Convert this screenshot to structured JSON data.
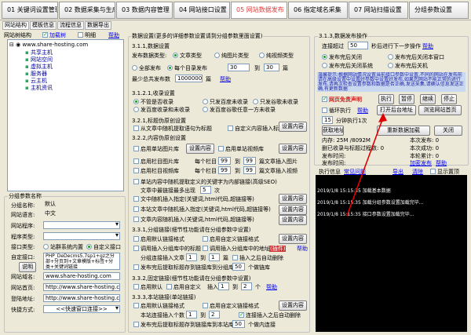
{
  "tabs": [
    "01 关键词设置管理",
    "02 数据采集与生成",
    "03 数据内容管理",
    "04 网站接口设置",
    "05 网站数据发布",
    "06 指定域名采集",
    "07 网站扫描设置",
    "分组参数设置"
  ],
  "subtabs": [
    "网站结构",
    "模板信息",
    "流程信息",
    "数据导出"
  ],
  "left": {
    "title": "网站树结构",
    "add_label": "加载树",
    "clear_label": "明细",
    "help": "帮助",
    "tree": [
      "www.share-hosting.com",
      "共享主机",
      "网站空间",
      "虚拟主机",
      "服务器",
      "云主机",
      "主机资讯"
    ],
    "params_title": "分组参数名称",
    "fields": [
      [
        "分组名称:",
        "默认"
      ],
      [
        "网站语言:",
        "中文"
      ],
      [
        "网站程序:",
        ""
      ],
      [
        "程序类型:",
        ""
      ],
      [
        "接口类型:",
        ""
      ],
      [
        "自定接口:",
        ""
      ]
    ],
    "interface_radio1": "站群系统内置",
    "interface_radio2": "自定义接口",
    "explain": "说明",
    "desc_text": "PHP_DeDecms5.7sp1+gz之分部+分页到+文章模版+标签+分类+关键词链接",
    "domain_label": "网站域名:",
    "domain": "www.share-hosting.com",
    "home_label": "网站首页:",
    "home": "http://www.share-hosting.com",
    "login_label": "登陆地址:",
    "login": "http://www.share-hosting.com",
    "fast_label": "快捷方式:",
    "fast": "<<快速窗口连接>>"
  },
  "mid": {
    "title": "数据设置(更多的详细参数设置请到分组参数里面设置)",
    "s1": "3.1.1,数据设置",
    "pubtype_label": "发布数据类型:",
    "pubtype": [
      "文章类型",
      "纯图片类型",
      "纯视频类型"
    ],
    "mode": [
      "全部发布",
      "每个目录发布"
    ],
    "mode_num": "30",
    "to": "到",
    "mode_num2": "30",
    "unit": "篇",
    "min_label": "最少总共发布数",
    "min_val": "1000000",
    "unit2": "篇",
    "help": "帮助",
    "s2": "3.1.2.1,收录设置",
    "inc": [
      "不管是否收录",
      "只发百度未收录",
      "只发谷歌未收录",
      "发百度收录和未收录",
      "发百度谷歌任意一方未收录"
    ],
    "s3": "3.2.1,标题伪原创设置",
    "s3a": "从文章中随机提取语句为标题",
    "s3b": "自定义内容插入标题",
    "set": "设置内容",
    "s4": "3.2.2,内容伪原创设置",
    "c1": "启用单站图片库",
    "c2": "启用单站视频库",
    "c3": "启用栏目图片库",
    "c3b": "每个栏目",
    "n99": "99",
    "c3c": "到",
    "c3d": "篇文章插入图片",
    "c4": "启用栏目视频库",
    "c4d": "篇文章插入视频",
    "c5": "单站内容中随机提取定义的关键字为内部链接(高级SEO)",
    "c5b": "文章中最链接最多出现",
    "c5n": "5",
    "c5c": "次",
    "c6": "文中随机插入指定(关键词,html代码,超链接等)",
    "c7": "本站文章中随机插入指定(关键词,html代码,超链接等)",
    "c8": "文章内容随机插入(关键词,html代码,超链接等)",
    "s5": "3.3.1,分组链接(细节性功能请在分组参数中设置)",
    "g1": "启用默认链接格式",
    "g2": "启用自定义链接格式",
    "g3": "调用插入分组库中的标题",
    "g4": "调用插入分组库中的地址",
    "g5": "(插件)",
    "g6": "分组连接插入文章",
    "g6n": "1",
    "g6b": "到",
    "g6n2": "1",
    "g6c": "篇",
    "g7": "插入之后自动删除",
    "g8": "发布完后提取标题存到链接库到分组库",
    "g8n": "50",
    "g8c": "个做链库",
    "s6": "3.3.2,固定链接(细节性功能请在分组参数中设置)",
    "f1": "启用默认",
    "f2": "启用自定义",
    "f3": "插入",
    "f3n": "1",
    "f3b": "到",
    "f3n2": "2",
    "f3c": "个",
    "s7": "3.3.3,本站链接(单站链接)",
    "l1": "启用默认链接格式",
    "l2": "启用自定义链接格式",
    "l3": "本站连接插入个数",
    "l3n": "1",
    "l3b": "到",
    "l3n2": "2",
    "l4": "连接插入之后自动删除",
    "l5": "发布完后提取标题存到链接库到本站库",
    "l5n": "50",
    "l5c": "个做内连接"
  },
  "right": {
    "title": "3.1.3,数据发布操作",
    "interval_label": "连接超过",
    "interval": "50",
    "interval_unit": "秒后进行下一步操作",
    "help": "帮助",
    "r1": "发布完后关闭",
    "r2": "发布完后关闭本窗口",
    "r3": "发布完后关闭系统",
    "r4": "发布完后关机",
    "notice": "温馨提示:根据网站情况设置当前接口参数中设置,不同的网站在发布前请在高级设置中设置好参数中设置好发布,如果您网站不能正常的进行发布,请再次检查设置参数和数据是否正确,发送采集,请确认信息发送正确,有更新数据",
    "recheck": "网页免责声明",
    "run": "执行",
    "pause": "暂停",
    "resume": "继续",
    "stop": "停止",
    "loop": "循环执行",
    "sec_label": "小时",
    "help2": "帮助",
    "open_bg": "打开后台地址",
    "browse": "浏览网站首页",
    "every": "15",
    "every_unit": "分钟执行1次",
    "get": "获取地址",
    "reget": "重新数据加载",
    "close": "关闭",
    "stat1": "内存: 25M /8092M",
    "stat2": "本次发布: 0",
    "stat3": "删已收录与标题过程数: 0",
    "stat4": "本次成功: 0",
    "stat5": "发布时间:",
    "stat6": "本轮累计: 0",
    "stat7": "发布时间:",
    "stat8": "加密发布",
    "help3": "帮助",
    "log_title": "执行信息",
    "log_help": "常见问题",
    "log_export": "导出",
    "log_clear": "清除",
    "log_top": "显示置顶",
    "log": [
      "2019/1/8 15:15:35  加载基本数据",
      "2019/1/8 15:15:35  加载分组参数设置加载完毕...",
      "2019/1/8 15:15:35  接口参数设置加载完毕..."
    ]
  },
  "colors": {
    "accent": "#e23d3d",
    "link": "#0000ee"
  }
}
